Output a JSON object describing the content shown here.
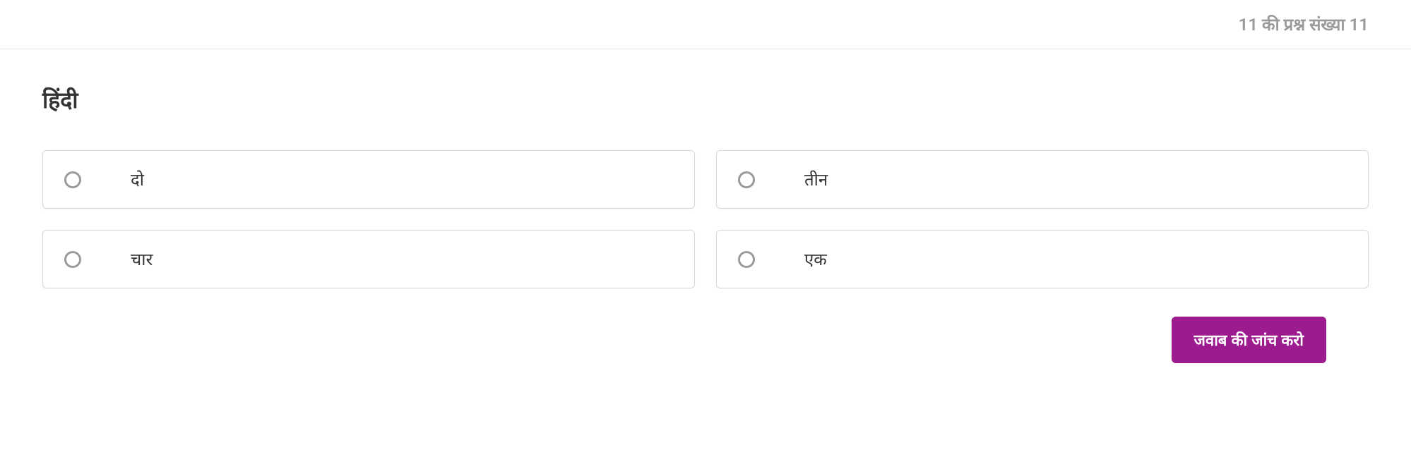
{
  "header": {
    "progress": "11 की प्रश्न संख्या 11"
  },
  "question": {
    "title": "हिंदी"
  },
  "options": [
    {
      "label": "दो"
    },
    {
      "label": "तीन"
    },
    {
      "label": "चार"
    },
    {
      "label": "एक"
    }
  ],
  "actions": {
    "check_answer": "जवाब की जांच करो"
  }
}
